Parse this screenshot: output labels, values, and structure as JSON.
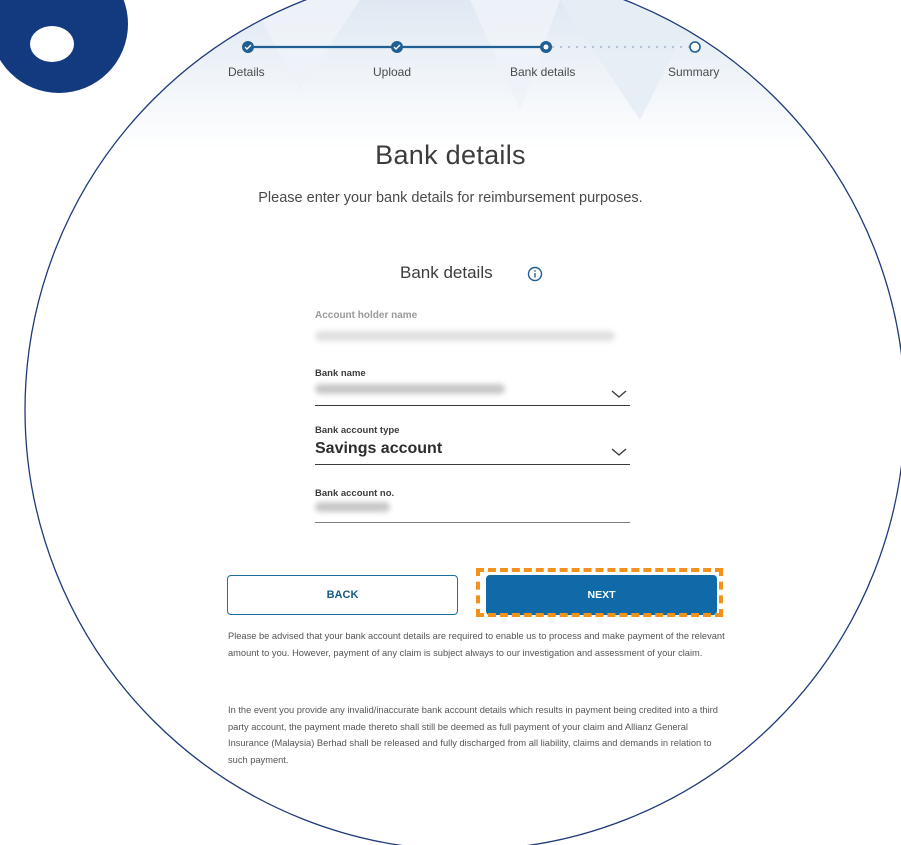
{
  "stepper": {
    "steps": [
      {
        "label": "Details",
        "state": "completed"
      },
      {
        "label": "Upload",
        "state": "completed"
      },
      {
        "label": "Bank details",
        "state": "current"
      },
      {
        "label": "Summary",
        "state": "pending"
      }
    ],
    "progress_fraction": 0.67
  },
  "page": {
    "title": "Bank details",
    "subtitle": "Please enter your bank details for reimbursement purposes.",
    "section_title": "Bank details"
  },
  "form": {
    "account_holder": {
      "label": "Account holder name"
    },
    "bank_name": {
      "label": "Bank name"
    },
    "account_type": {
      "label": "Bank account type",
      "value": "Savings account"
    },
    "account_no": {
      "label": "Bank account no."
    }
  },
  "actions": {
    "back_label": "BACK",
    "next_label": "NEXT"
  },
  "notices": [
    "Please be advised that your bank account details are required to enable us to process and make payment of the relevant amount to you. However, payment of any claim is subject always to our investigation and assessment of your claim.",
    "In the event you provide any invalid/inaccurate bank account details which results in payment being credited into a third party account, the payment made thereto shall still be deemed as full payment of your claim and Allianz General Insurance (Malaysia) Berhad shall be released and fully discharged from all liability, claims and demands in relation to such payment."
  ],
  "icons": [
    "check-icon",
    "info-icon",
    "chevron-down-icon"
  ],
  "colors": {
    "brand_navy": "#13397f",
    "primary_blue": "#0f6aa7",
    "circle_outline": "#1f3a7a",
    "highlight_orange": "#f2911b",
    "text_dark": "#3c3c3c"
  }
}
